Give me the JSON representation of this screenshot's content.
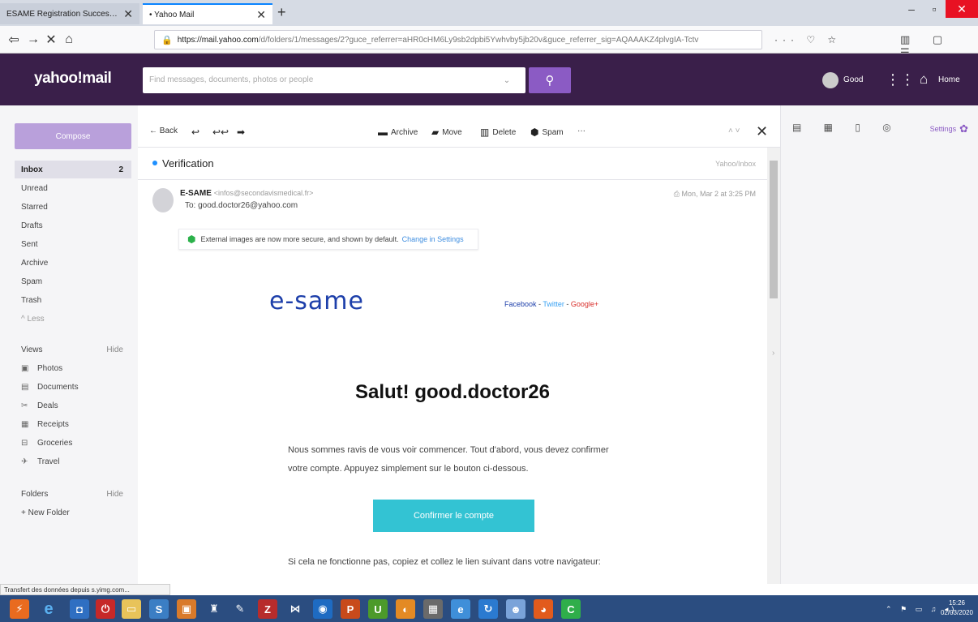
{
  "browser": {
    "tabs": [
      {
        "title": "ESAME Registration Successful",
        "close": "✕"
      },
      {
        "title": "• Yahoo Mail",
        "close": "✕"
      }
    ],
    "new_tab": "+",
    "url_host": "https://mail.yahoo.com",
    "url_path": "/d/folders/1/messages/2?guce_referrer=aHR0cHM6Ly9sb2dpbi5Ywhvby5jb20v&guce_referrer_sig=AQAAAKZ4plvgIA-Tctv",
    "url_extras": "··· ♡ ☆",
    "status": "Transfert des données depuis s.yimg.com..."
  },
  "header": {
    "logo": "yahoo!mail",
    "search_placeholder": "Find messages, documents, photos or people",
    "user": "Good",
    "home": "Home"
  },
  "sidebar": {
    "compose": "Compose",
    "folders": [
      {
        "label": "Inbox",
        "count": "2",
        "active": true
      },
      {
        "label": "Unread"
      },
      {
        "label": "Starred"
      },
      {
        "label": "Drafts"
      },
      {
        "label": "Sent"
      },
      {
        "label": "Archive"
      },
      {
        "label": "Spam"
      },
      {
        "label": "Trash"
      },
      {
        "label": "^ Less"
      }
    ],
    "views_label": "Views",
    "views_hide": "Hide",
    "views": [
      {
        "label": "Photos",
        "icon": "photo-icon"
      },
      {
        "label": "Documents",
        "icon": "document-icon"
      },
      {
        "label": "Deals",
        "icon": "scissors-icon"
      },
      {
        "label": "Receipts",
        "icon": "receipt-icon"
      },
      {
        "label": "Groceries",
        "icon": "basket-icon"
      },
      {
        "label": "Travel",
        "icon": "plane-icon"
      }
    ],
    "folders_label": "Folders",
    "folders_hide": "Hide",
    "new_folder": "+ New Folder"
  },
  "toolbar": {
    "back": "← Back",
    "archive": "Archive",
    "move": "Move",
    "delete": "Delete",
    "spam": "Spam",
    "more": "···"
  },
  "message": {
    "subject": "Verification",
    "folder_path": "Yahoo/Inbox",
    "sender_name": "E-SAME",
    "sender_addr": "<infos@secondavismedical.fr>",
    "to": "To: good.doctor26@yahoo.com",
    "date": "Mon, Mar 2 at 3:25 PM",
    "notice_text": "External images are now more secure, and shown by default.",
    "notice_link": "Change in Settings"
  },
  "email": {
    "logo_text": "e-same",
    "social_facebook": "Facebook",
    "social_twitter": "Twitter",
    "social_google": "Google+",
    "greeting": "Salut! good.doctor26",
    "intro": "Nous sommes ravis de vous voir commencer. Tout d'abord, vous devez confirmer votre compte. Appuyez simplement sur le bouton ci-dessous.",
    "button": "Confirmer le compte",
    "fallback": "Si cela ne fonctionne pas, copiez et collez le lien suivant dans votre navigateur:"
  },
  "rightpane": {
    "settings": "Settings"
  },
  "taskbar": {
    "time": "15:26",
    "date": "02/03/2020"
  },
  "colors": {
    "yahoo_purple": "#3a1f4a",
    "accent": "#8b5bc4",
    "button_teal": "#33c3d3"
  }
}
